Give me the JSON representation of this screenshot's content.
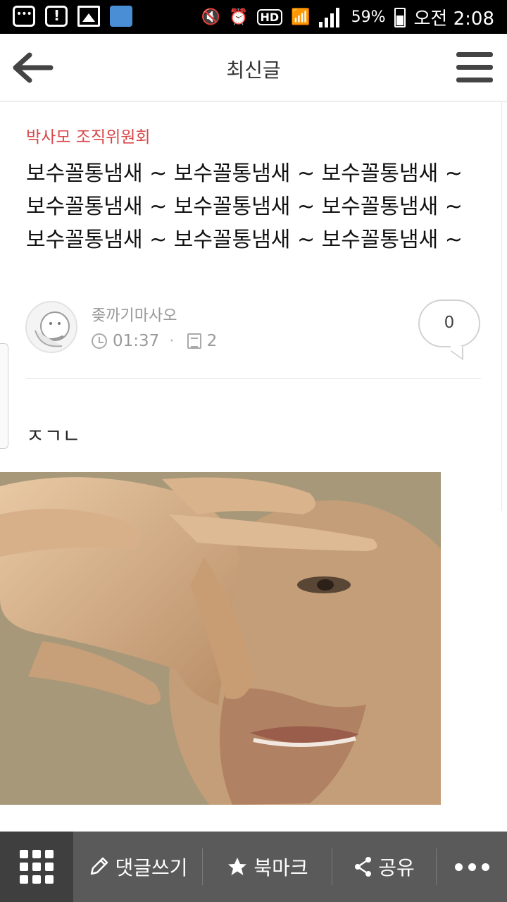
{
  "status_bar": {
    "battery": "59%",
    "time": "오전 2:08",
    "network_label": "HD"
  },
  "header": {
    "title": "최신글",
    "back_icon": "arrow-left-icon",
    "menu_icon": "hamburger-menu-icon"
  },
  "post": {
    "category": "박사모 조직위원회",
    "title": "보수꼴통냄새 ~ 보수꼴통냄새 ~ 보수꼴통냄새 ~ 보수꼴통냄새 ~ 보수꼴통냄새 ~ 보수꼴통냄새 ~ 보수꼴통냄새 ~ 보수꼴통냄새 ~ 보수꼴통냄새 ~",
    "author": "좆까기마사오",
    "time": "01:37",
    "views": "2",
    "comment_count": "0",
    "body_text": "ㅈㄱㄴ"
  },
  "toolbar": {
    "comment": "댓글쓰기",
    "bookmark": "북마크",
    "share": "공유"
  },
  "colors": {
    "category": "#d9464a",
    "toolbar_bg": "#5a5a5a",
    "toolbar_grid_bg": "#3f3f3f"
  }
}
